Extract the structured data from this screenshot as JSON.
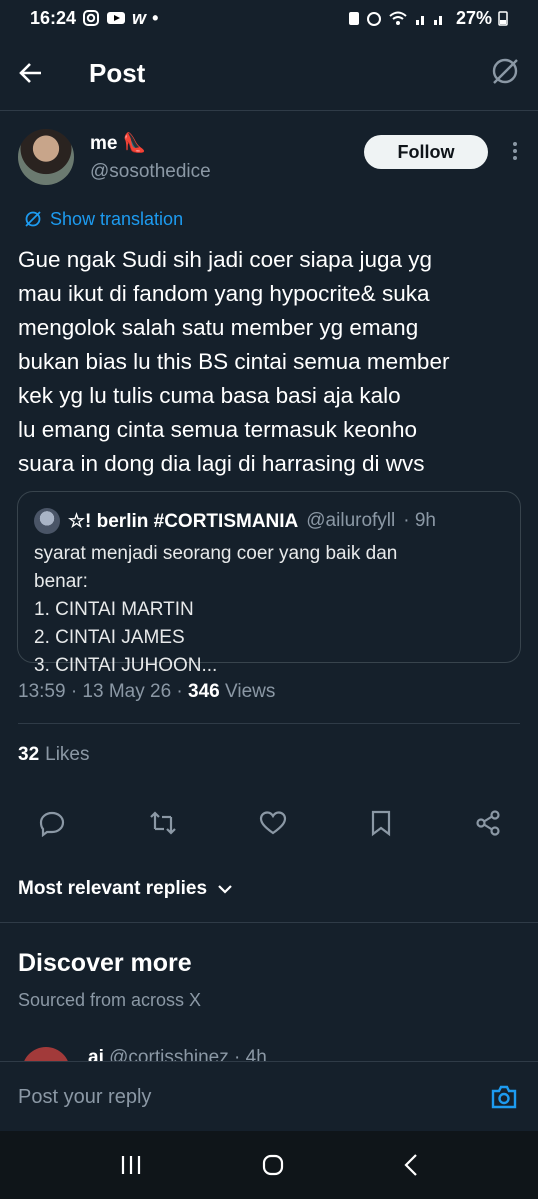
{
  "status": {
    "time": "16:24",
    "battery": "27%"
  },
  "header": {
    "title": "Post"
  },
  "author": {
    "name": "me 👠",
    "handle": "@sosothedice",
    "follow_label": "Follow"
  },
  "translate_label": "Show translation",
  "tweet_text": "Gue ngak Sudi sih jadi coer siapa juga yg\nmau ikut di fandom yang hypocrite& suka\nmengolok salah satu member yg emang\nbukan bias lu this BS cintai semua member\nkek yg lu tulis cuma basa basi aja kalo\nlu emang cinta semua termasuk keonho\nsuara in dong dia lagi di harrasing di wvs",
  "quote": {
    "name": "☆! berlin #CORTISMANIA",
    "handle": "@ailurofyll",
    "time": "· 9h",
    "text": "syarat menjadi seorang coer yang baik dan\nbenar:\n1. CINTAI MARTIN\n2. CINTAI JAMES\n3. CINTAI JUHOON..."
  },
  "meta": {
    "time": "13:59",
    "date": "· 13 May 26 ·",
    "views_count": "346",
    "views_label": "Views"
  },
  "likes": {
    "count": "32",
    "label": "Likes"
  },
  "replies_sort": "Most relevant replies",
  "discover": {
    "title": "Discover more",
    "subtitle": "Sourced from across X"
  },
  "peek": {
    "name": "ai",
    "handle": "@cortisshinez · 4h"
  },
  "reply_placeholder": "Post your reply",
  "colors": {
    "background": "#15202b",
    "accent": "#1d9bf0",
    "text": "#e7e9ea",
    "muted": "#8b98a5"
  }
}
